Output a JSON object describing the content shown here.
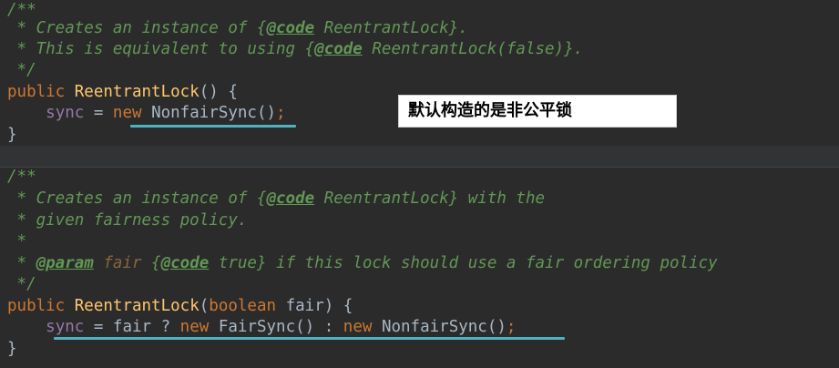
{
  "block1": {
    "comment_open": "/**",
    "doc_line1_pre": " * Creates an instance of {",
    "doc_line1_tag": "@code",
    "doc_line1_post": " ReentrantLock}.",
    "doc_line2_pre": " * This is equivalent to using {",
    "doc_line2_tag": "@code",
    "doc_line2_post": " ReentrantLock(false)}.",
    "comment_close": " */",
    "sig_kw": "public",
    "sig_name": "ReentrantLock",
    "sig_rest": "() {",
    "body_indent": "    ",
    "body_field": "sync",
    "body_eq": " = ",
    "body_new": "new",
    "body_class": " NonfairSync",
    "body_call": "()",
    "body_semi": ";",
    "close_brace": "}"
  },
  "callout": {
    "text": "默认构造的是非公平锁"
  },
  "block2": {
    "comment_open": "/**",
    "doc_line1_pre": " * Creates an instance of {",
    "doc_line1_tag": "@code",
    "doc_line1_post": " ReentrantLock} with the",
    "doc_line2": " * given fairness policy.",
    "doc_line3": " *",
    "doc_line4_star": " * ",
    "doc_line4_param": "@param",
    "doc_line4_name": " fair",
    "doc_line4_brace": " {",
    "doc_line4_tag": "@code",
    "doc_line4_post": " true} if this lock should use a fair ordering policy",
    "comment_close": " */",
    "sig_kw": "public",
    "sig_name": "ReentrantLock",
    "sig_open": "(",
    "sig_type": "boolean",
    "sig_param": " fair",
    "sig_close": ") {",
    "body_indent": "    ",
    "body_field": "sync",
    "body_eq": " = fair ? ",
    "body_new1": "new",
    "body_class1": " FairSync",
    "body_call1": "() : ",
    "body_new2": "new",
    "body_class2": " NonfairSync",
    "body_call2": "()",
    "body_semi": ";",
    "close_brace": "}"
  },
  "colors": {
    "background": "#2b2b2b",
    "comment": "#629755",
    "keyword": "#cc7832",
    "method": "#ffc66d",
    "field": "#9876aa",
    "text": "#a9b7c6",
    "highlight_underline": "#4fb3bf"
  }
}
